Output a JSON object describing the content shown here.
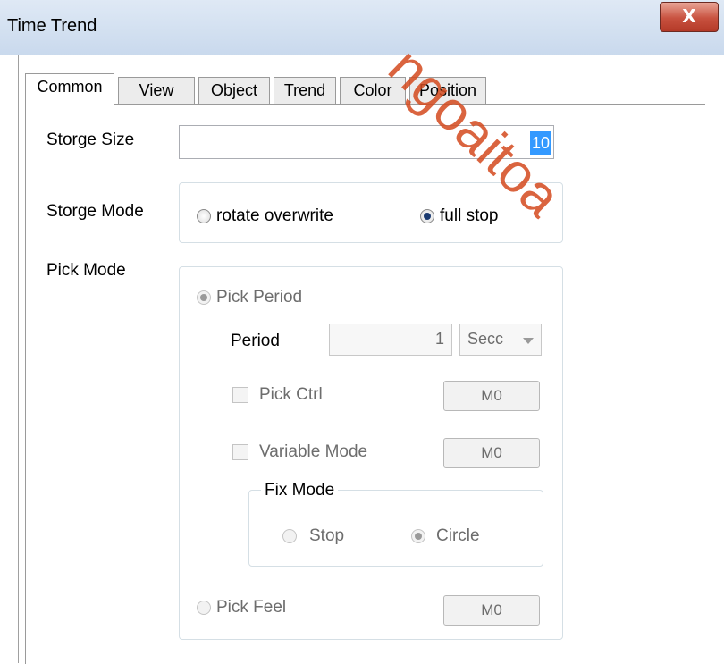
{
  "window": {
    "title": "Time Trend",
    "close_label": "X"
  },
  "tabs": [
    {
      "label": "Common",
      "active": true
    },
    {
      "label": "View"
    },
    {
      "label": "Object"
    },
    {
      "label": "Trend"
    },
    {
      "label": "Color"
    },
    {
      "label": "Position"
    }
  ],
  "storge_size": {
    "label": "Storge Size",
    "value": "10"
  },
  "storge_mode": {
    "label": "Storge Mode",
    "options": [
      "rotate overwrite",
      "full stop"
    ],
    "selected": "full stop"
  },
  "pick_mode": {
    "label": "Pick Mode",
    "pick_period": {
      "label": "Pick Period",
      "selected": true
    },
    "period": {
      "label": "Period",
      "value": "1",
      "unit": "Secc"
    },
    "pick_ctrl": {
      "label": "Pick Ctrl",
      "button": "M0"
    },
    "variable_mode": {
      "label": "Variable Mode",
      "button": "M0"
    },
    "fix_mode": {
      "label": "Fix Mode",
      "options": [
        "Stop",
        "Circle"
      ],
      "selected": "Circle"
    },
    "pick_feel": {
      "label": "Pick Feel",
      "button": "M0"
    }
  },
  "watermark": "ngoaitoa"
}
